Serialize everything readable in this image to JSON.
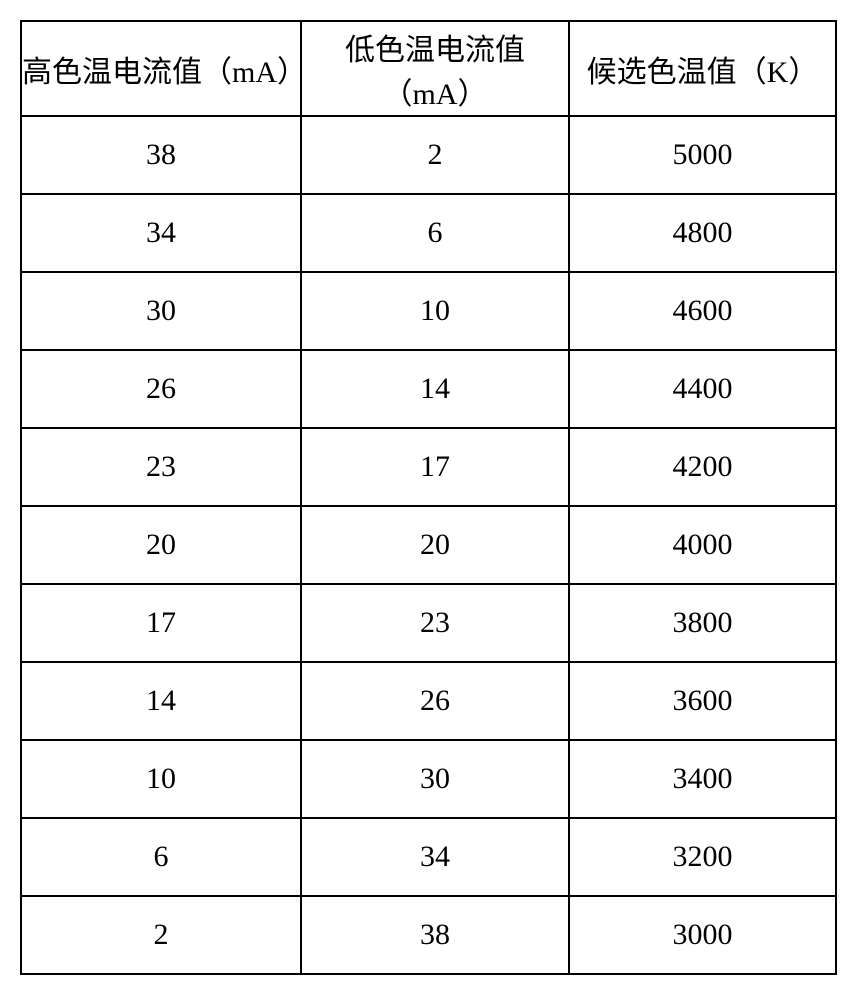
{
  "table": {
    "headers": [
      "高色温电流值（mA）",
      "低色温电流值（mA）",
      "候选色温值（K）"
    ],
    "rows": [
      [
        "38",
        "2",
        "5000"
      ],
      [
        "34",
        "6",
        "4800"
      ],
      [
        "30",
        "10",
        "4600"
      ],
      [
        "26",
        "14",
        "4400"
      ],
      [
        "23",
        "17",
        "4200"
      ],
      [
        "20",
        "20",
        "4000"
      ],
      [
        "17",
        "23",
        "3800"
      ],
      [
        "14",
        "26",
        "3600"
      ],
      [
        "10",
        "30",
        "3400"
      ],
      [
        "6",
        "34",
        "3200"
      ],
      [
        "2",
        "38",
        "3000"
      ]
    ]
  }
}
